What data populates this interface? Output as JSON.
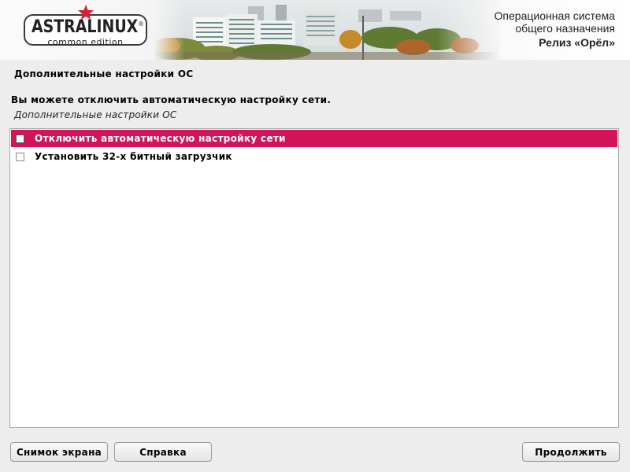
{
  "header": {
    "logo_text": "ASTRALINUX",
    "logo_reg": "®",
    "logo_subtitle": "common edition",
    "os_line1": "Операционная система",
    "os_line2": "общего назначения",
    "release": "Релиз «Орёл»",
    "logo_star_color": "#d4232f"
  },
  "page": {
    "section_title": "Дополнительные настройки ОС",
    "question": "Вы можете отключить автоматическую настройку сети.",
    "hint": "Дополнительные настройки ОС"
  },
  "options": [
    {
      "label": "Отключить автоматическую настройку сети",
      "checked": false,
      "selected": true
    },
    {
      "label": "Установить 32-х битный загрузчик",
      "checked": false,
      "selected": false
    }
  ],
  "buttons": {
    "screenshot": "Снимок экрана",
    "help": "Справка",
    "continue": "Продолжить"
  },
  "colors": {
    "selection": "#d3145a",
    "background": "#ededed"
  }
}
